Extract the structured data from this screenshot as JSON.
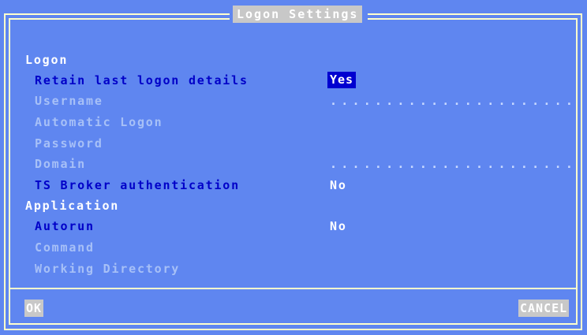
{
  "dialog": {
    "title": "Logon Settings"
  },
  "sections": {
    "logon": "Logon",
    "application": "Application"
  },
  "fields": {
    "retain_label": "Retain last logon details",
    "retain_value": "Yes",
    "username_label": "Username",
    "username_value": "......................",
    "auto_logon_label": "Automatic Logon",
    "password_label": "Password",
    "domain_label": "Domain",
    "domain_value": "......................",
    "ts_broker_label": "TS Broker authentication",
    "ts_broker_value": "No",
    "autorun_label": "Autorun",
    "autorun_value": "No",
    "command_label": "Command",
    "working_dir_label": "Working Directory"
  },
  "buttons": {
    "ok": "OK",
    "cancel": "CANCEL"
  },
  "colors": {
    "background": "#5f86f0",
    "frame": "#ffffcc",
    "selection": "#0000d0",
    "active_label": "#0000c8",
    "disabled_label": "#a7c0f7"
  }
}
